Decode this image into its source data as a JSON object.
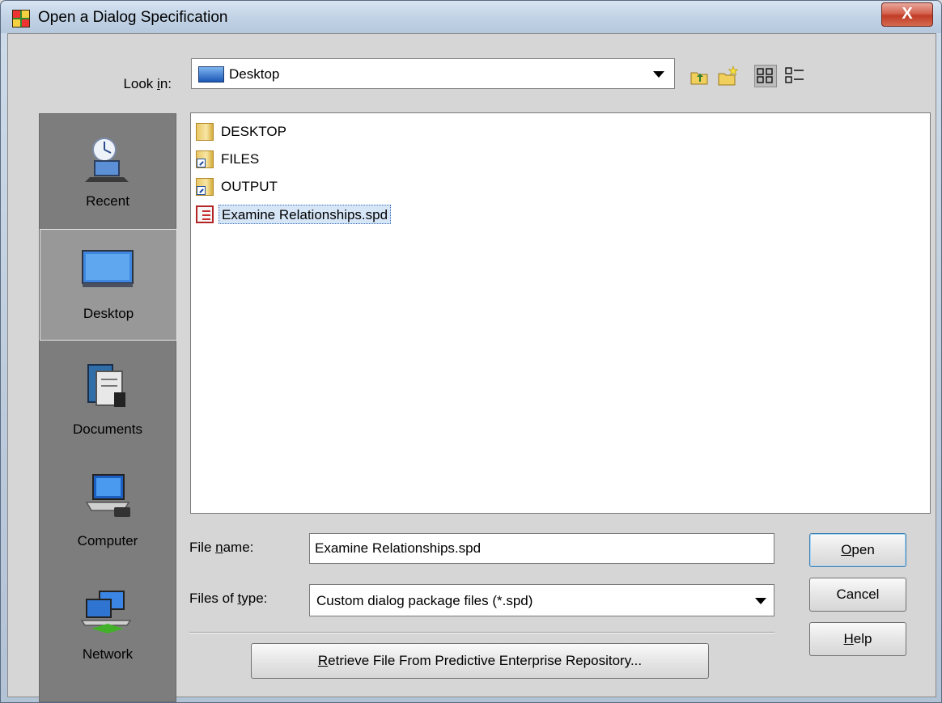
{
  "window": {
    "title": "Open a Dialog Specification",
    "close_label": "X"
  },
  "lookin": {
    "label_pre": "Look ",
    "label_mnemonic": "i",
    "label_post": "n:",
    "value": "Desktop",
    "toolbar_icons": [
      "up-one-level-icon",
      "create-new-folder-icon",
      "list-view-icon",
      "details-view-icon"
    ]
  },
  "places": [
    {
      "label": "Recent",
      "icon": "recent-icon",
      "selected": false
    },
    {
      "label": "Desktop",
      "icon": "desktop-icon",
      "selected": true
    },
    {
      "label": "Documents",
      "icon": "documents-icon",
      "selected": false
    },
    {
      "label": "Computer",
      "icon": "computer-icon",
      "selected": false
    },
    {
      "label": "Network",
      "icon": "network-icon",
      "selected": false
    }
  ],
  "files": [
    {
      "name": "DESKTOP",
      "type": "folder",
      "selected": false
    },
    {
      "name": "FILES",
      "type": "folder-shortcut",
      "selected": false
    },
    {
      "name": "OUTPUT",
      "type": "folder-shortcut",
      "selected": false
    },
    {
      "name": "Examine Relationships.spd",
      "type": "spd",
      "selected": true
    }
  ],
  "file_name": {
    "label_pre": "File ",
    "label_mnemonic": "n",
    "label_post": "ame:",
    "value": "Examine Relationships.spd"
  },
  "file_type": {
    "label_pre": "Files of ",
    "label_mnemonic": "t",
    "label_post": "ype:",
    "value": "Custom dialog package files (*.spd)"
  },
  "buttons": {
    "open_mnemonic": "O",
    "open_rest": "pen",
    "cancel": "Cancel",
    "help_mnemonic": "H",
    "help_rest": "elp",
    "retrieve_mnemonic": "R",
    "retrieve_rest": "etrieve File From Predictive Enterprise Repository..."
  },
  "colors": {
    "places_bg": "#7d7d7d",
    "selection_fill": "#d6e6f7",
    "default_button_border": "#3c7fb1"
  }
}
